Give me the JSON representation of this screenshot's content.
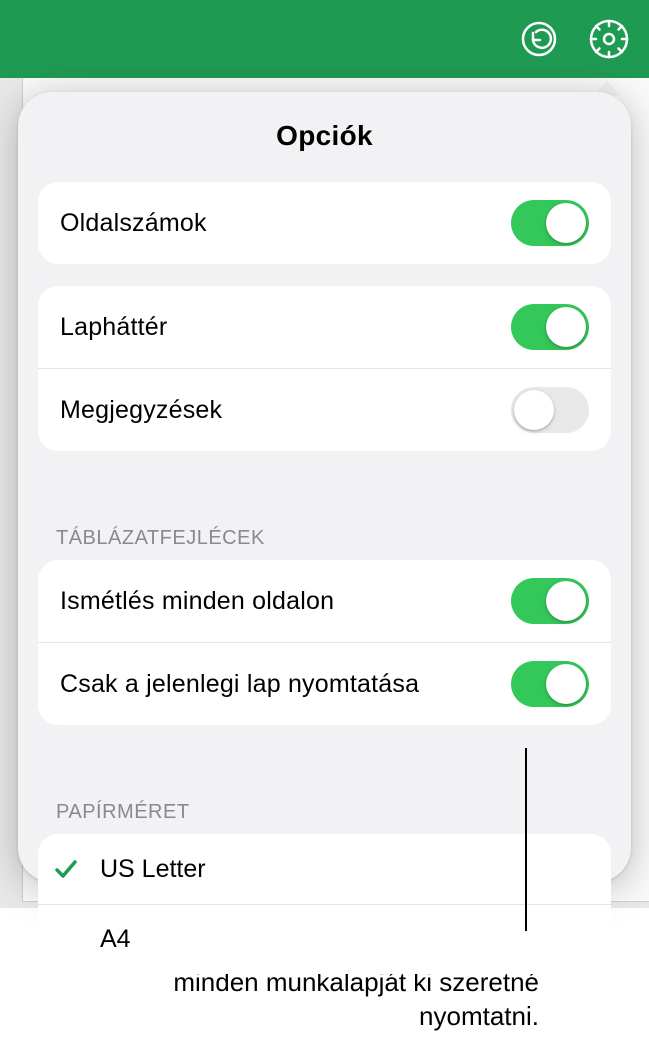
{
  "header": {
    "undo_icon": "undo-circle",
    "settings_icon": "gear-circle"
  },
  "panel": {
    "title": "Opciók"
  },
  "group1": {
    "page_numbers": {
      "label": "Oldalszámok",
      "on": "true"
    }
  },
  "group2": {
    "background": {
      "label": "Lapháttér",
      "on": "true"
    },
    "comments": {
      "label": "Megjegyzések",
      "on": "false"
    }
  },
  "section_headers": {
    "table_headers": "TÁBLÁZATFEJLÉCEK",
    "paper_size": "PAPÍRMÉRET"
  },
  "group3": {
    "repeat_every_page": {
      "label": "Ismétlés minden oldalon",
      "on": "true"
    },
    "print_current_only": {
      "label": "Csak a jelenlegi lap nyomtatása",
      "on": "true"
    }
  },
  "paper_sizes": {
    "us_letter": {
      "label": "US Letter",
      "selected": "true"
    },
    "a4": {
      "label": "A4",
      "selected": "false"
    }
  },
  "callout": {
    "text": "Kapcsolja ki ezt a funkciót, ha a táblázat minden munkalapját ki szeretné nyomtatni."
  },
  "colors": {
    "accent": "#1f9a53",
    "toggle_on": "#34c759"
  }
}
